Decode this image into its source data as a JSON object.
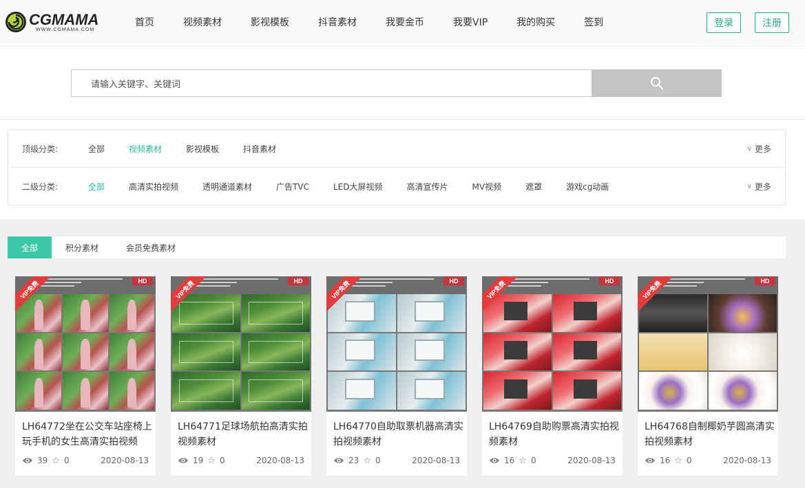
{
  "header": {
    "logo": {
      "title": "CGMAMA",
      "subtitle": "WWW.CGMAMA.COM"
    },
    "nav": [
      "首页",
      "视频素材",
      "影视模板",
      "抖音素材",
      "我要金币",
      "我要VIP",
      "我的购买",
      "签到"
    ],
    "login_label": "登录",
    "register_label": "注册",
    "brand_color": "#2aa88f"
  },
  "search": {
    "placeholder": "请输入关键字、关键词",
    "button_icon": "search-icon"
  },
  "filter": {
    "top": {
      "label": "顶级分类:",
      "options": [
        "全部",
        "视频素材",
        "影视模板",
        "抖音素材"
      ],
      "active_index": 1,
      "more": "更多"
    },
    "second": {
      "label": "二级分类:",
      "options": [
        "全部",
        "高清实拍视频",
        "透明通道素材",
        "广告TVC",
        "LED大屏视频",
        "高清宣传片",
        "MV视频",
        "遮罩",
        "游戏cg动画"
      ],
      "active_index": 0,
      "more": "更多"
    },
    "active_color": "#2ab89a"
  },
  "tabs": {
    "items": [
      "全部",
      "积分素材",
      "会员免费素材"
    ],
    "active_index": 0,
    "active_color": "#3cc7a6"
  },
  "cards": [
    {
      "title": "LH64772坐在公交车站座椅上玩手机的女生高清实拍视频",
      "views": "39",
      "stars": "0",
      "date": "2020-08-13",
      "badge": "HD",
      "ribbon": "VIP免费",
      "theme": "bus",
      "cols": 3
    },
    {
      "title": "LH64771足球场航拍高清实拍视频素材",
      "views": "19",
      "stars": "0",
      "date": "2020-08-13",
      "badge": "HD",
      "ribbon": "VIP免费",
      "theme": "field",
      "cols": 2
    },
    {
      "title": "LH64770自助取票机器高清实拍视频素材",
      "views": "23",
      "stars": "0",
      "date": "2020-08-13",
      "badge": "HD",
      "ribbon": "VIP免费",
      "theme": "kiosk",
      "cols": 2
    },
    {
      "title": "LH64769自助购票高清实拍视频素材",
      "views": "16",
      "stars": "0",
      "date": "2020-08-13",
      "badge": "HD",
      "ribbon": "VIP免费",
      "theme": "ticket",
      "cols": 2
    },
    {
      "title": "LH64768自制椰奶芋圆高清实拍视频素材",
      "views": "16",
      "stars": "0",
      "date": "2020-08-13",
      "badge": "HD",
      "ribbon": "VIP免费",
      "theme": "food",
      "cols": 2
    }
  ]
}
